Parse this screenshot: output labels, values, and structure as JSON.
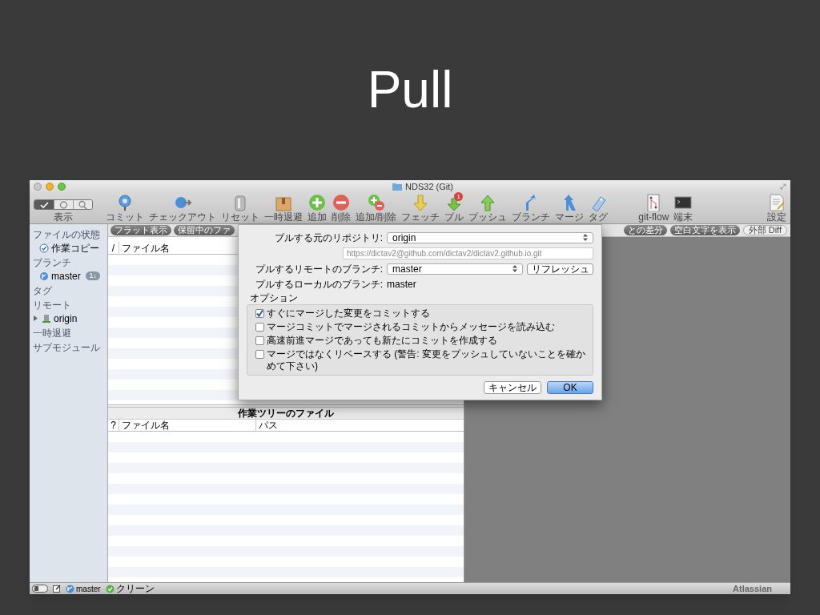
{
  "slide_title": "Pull",
  "window": {
    "title": "NDS32 (Git)"
  },
  "toolbar": {
    "view_modes": [
      {
        "selected": true
      },
      {
        "selected": false
      },
      {
        "selected": false
      }
    ],
    "view_label": "表示",
    "items": [
      {
        "label": "コミット"
      },
      {
        "label": "チェックアウト"
      },
      {
        "label": "リセット"
      },
      {
        "label": "一時退避"
      },
      {
        "label": "追加"
      },
      {
        "label": "削除"
      },
      {
        "label": "追加/削除"
      },
      {
        "label": "フェッチ"
      },
      {
        "label": "プル",
        "badge": "1"
      },
      {
        "label": "プッシュ"
      },
      {
        "label": "ブランチ"
      },
      {
        "label": "マージ"
      },
      {
        "label": "タグ"
      },
      {
        "label": "git-flow"
      },
      {
        "label": "端末"
      }
    ],
    "settings_label": "設定"
  },
  "sidebar": {
    "sections": [
      {
        "label": "ファイルの状態",
        "items": [
          {
            "label": "作業コピー"
          }
        ]
      },
      {
        "label": "ブランチ",
        "items": [
          {
            "label": "master",
            "badge": "1↓"
          }
        ]
      },
      {
        "label": "タグ"
      },
      {
        "label": "リモート",
        "items": [
          {
            "label": "origin",
            "expanded": false
          }
        ]
      },
      {
        "label": "一時退避"
      },
      {
        "label": "サブモジュール"
      }
    ]
  },
  "file_bar": {
    "left_buttons": [
      "フラット表示",
      "保留中のファ"
    ],
    "right_buttons": [
      "との差分",
      "空白文字を表示",
      "外部 Diff"
    ]
  },
  "upper_table": {
    "columns": [
      "/",
      "ファイル名"
    ]
  },
  "lower_table": {
    "title": "作業ツリーのファイル",
    "columns": [
      "?",
      "ファイル名",
      "パス"
    ]
  },
  "dialog": {
    "repository_label": "プルする元のリポジトリ:",
    "repository": "origin",
    "url": "https://dictav2@github.com/dictav2/dictav2.github.io.git",
    "remote_branch_label": "プルするリモートのブランチ:",
    "remote_branch": "master",
    "refresh_button": "リフレッシュ",
    "local_branch_label": "プルするローカルのブランチ:",
    "local_branch": "master",
    "options_label": "オプション",
    "options": [
      {
        "label": "すぐにマージした変更をコミットする",
        "checked": true
      },
      {
        "label": "マージコミットでマージされるコミットからメッセージを読み込む",
        "checked": false
      },
      {
        "label": "高速前進マージであっても新たにコミットを作成する",
        "checked": false
      },
      {
        "label": "マージではなくリベースする (警告: 変更をプッシュしていないことを確かめて下さい)",
        "checked": false
      }
    ],
    "cancel_button": "キャンセル",
    "ok_button": "OK"
  },
  "status_bar": {
    "branch": "master",
    "state": "クリーン",
    "brand": "Atlassian"
  }
}
